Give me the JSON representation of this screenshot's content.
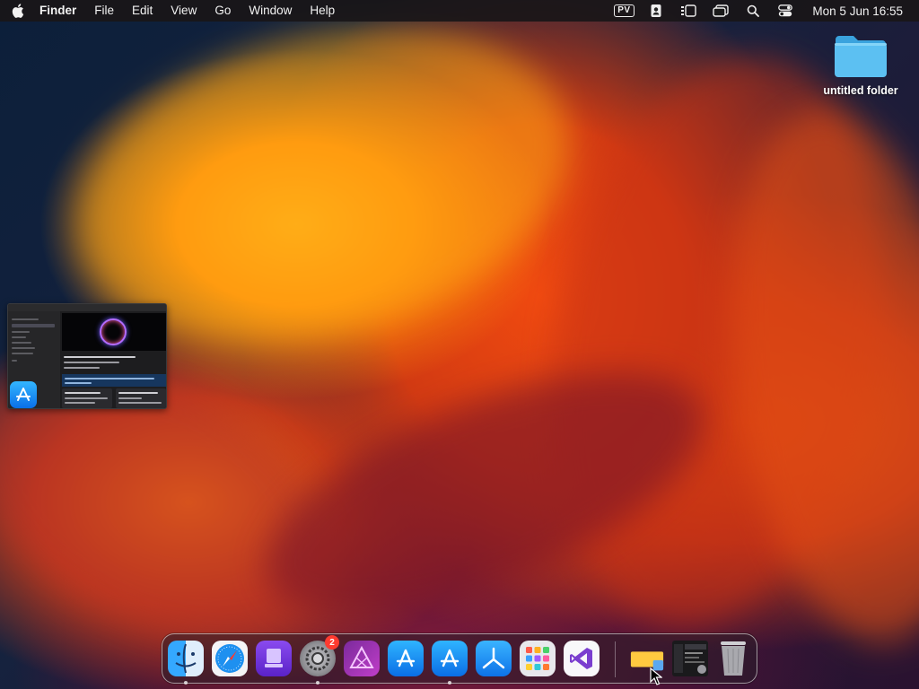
{
  "menubar": {
    "apple_icon": "apple-logo-icon",
    "app_name": "Finder",
    "menus": [
      "File",
      "Edit",
      "View",
      "Go",
      "Window",
      "Help"
    ],
    "status": {
      "pv_label": "PV",
      "clock": "Mon 5 Jun  16:55"
    }
  },
  "desktop": {
    "folder_label": "untitled folder",
    "folder_color": "#4cb8f0"
  },
  "dock": {
    "badge_count": "2",
    "apps": [
      "Finder",
      "Safari",
      "Apple Configurator",
      "System Settings",
      "Affinity Photo",
      "App Store",
      "App Store",
      "Xcode Instruments",
      "Launchpad",
      "Visual Studio"
    ]
  },
  "thumbnail": {
    "app": "App Store"
  }
}
